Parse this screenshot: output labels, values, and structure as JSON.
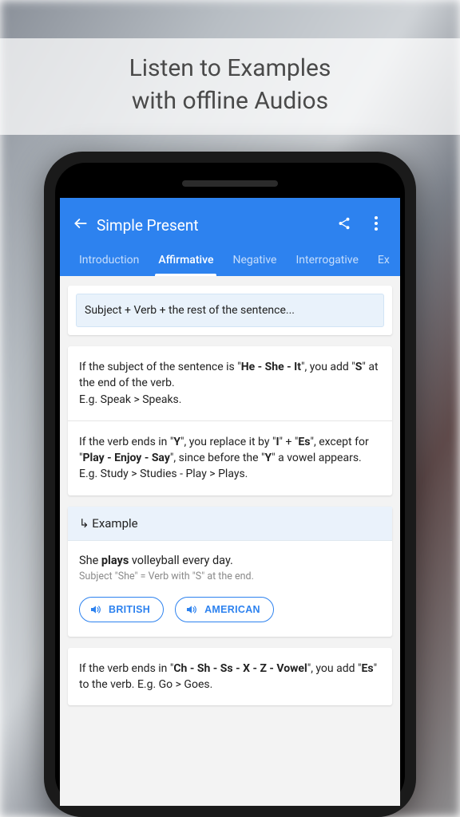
{
  "promo": {
    "line1": "Listen to Examples",
    "line2": "with offline Audios"
  },
  "appbar": {
    "title": "Simple Present"
  },
  "tabs": [
    {
      "label": "Introduction",
      "active": false
    },
    {
      "label": "Affirmative",
      "active": true
    },
    {
      "label": "Negative",
      "active": false
    },
    {
      "label": "Interrogative",
      "active": false
    },
    {
      "label": "Ex",
      "active": false
    }
  ],
  "formula": "Subject + Verb + the rest of the sentence...",
  "rule1": {
    "pre": "If the subject of the sentence is \"",
    "bold": "He - She - It",
    "post": "\", you add \"",
    "bold2": "S",
    "post2": "\" at the end of the verb.",
    "eg": "E.g. Speak > Speaks."
  },
  "rule2": {
    "pre": "If the verb ends in \"",
    "b1": "Y",
    "mid1": "\", you replace it by \"",
    "b2": "I",
    "mid2": "\" + \"",
    "b3": "Es",
    "mid3": "\", except for \"",
    "b4": "Play - Enjoy - Say",
    "mid4": "\", since before the \"",
    "b5": "Y",
    "post": "\" a vowel appears.",
    "eg": "E.g. Study > Studies - Play > Plays."
  },
  "example": {
    "header": "Example",
    "sentence_pre": "She ",
    "sentence_bold": "plays",
    "sentence_post": " volleyball every day.",
    "sub": "Subject \"She\" = Verb with \"S\" at the end.",
    "audio": {
      "british": "BRITISH",
      "american": "AMERICAN"
    }
  },
  "rule3": {
    "pre": "If the verb ends in \"",
    "b1": "Ch - Sh - Ss - X - Z - Vowel",
    "mid": "\", you add \"",
    "b2": "Es",
    "post": "\" to the verb. E.g. Go > Goes."
  }
}
